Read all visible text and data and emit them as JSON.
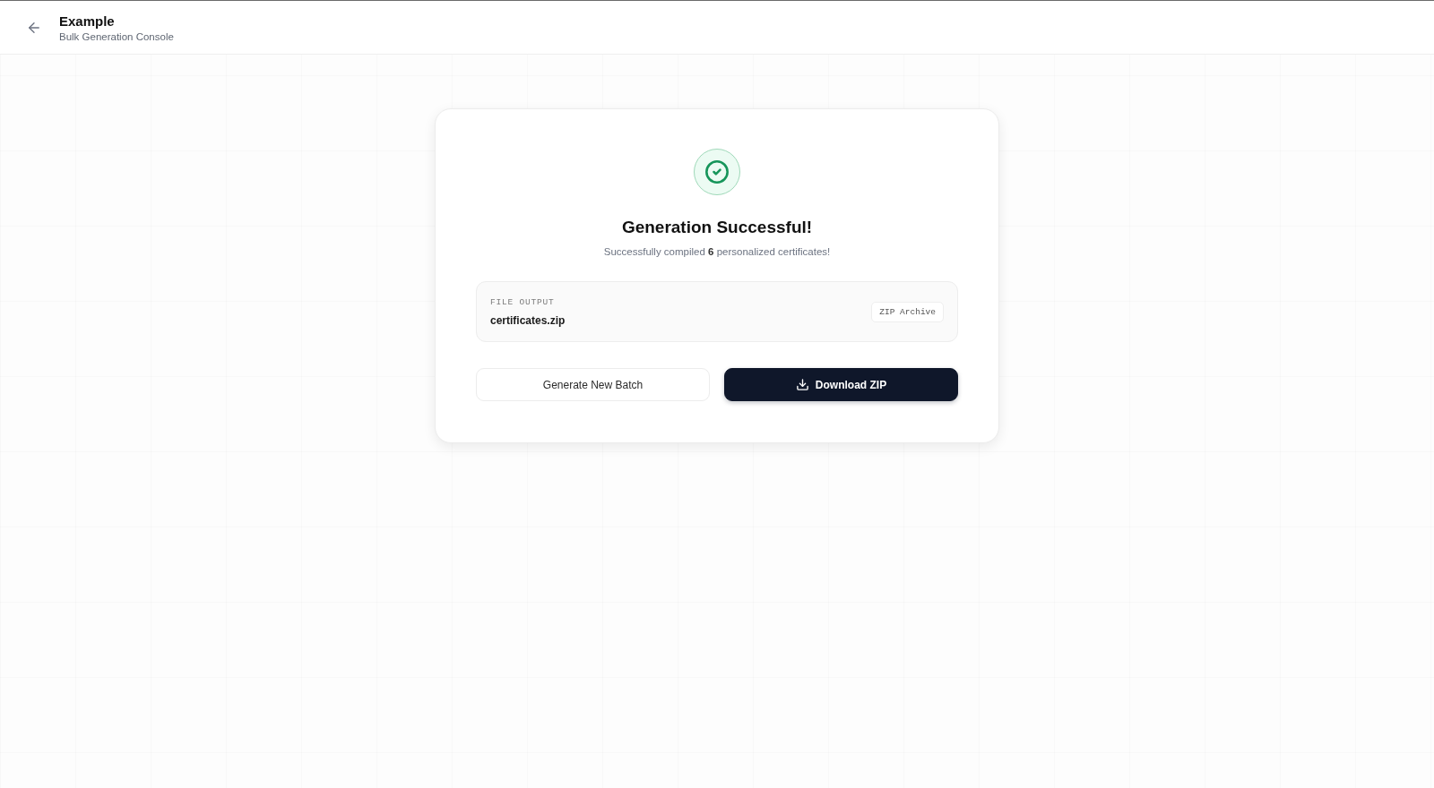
{
  "header": {
    "title": "Example",
    "subtitle": "Bulk Generation Console"
  },
  "result": {
    "title": "Generation Successful!",
    "message": "Successfully compiled **6** personalized certificates!",
    "file": {
      "label": "FILE OUTPUT",
      "name": "certificates.zip",
      "badge": "ZIP Archive"
    },
    "buttons": [
      {
        "label": "Generate New Batch",
        "kind": "secondary"
      },
      {
        "label": "Download ZIP",
        "kind": "primary"
      }
    ]
  }
}
